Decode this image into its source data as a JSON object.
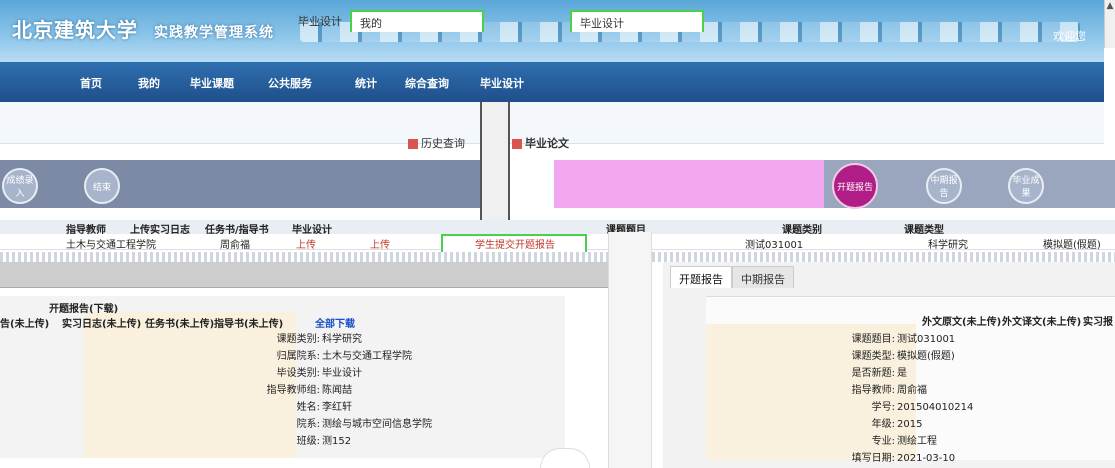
{
  "header": {
    "logo_text": "北京建筑大学",
    "subtitle": "实践教学管理系统",
    "user_text": "欢迎您"
  },
  "nav": {
    "items": [
      "首页",
      "我的",
      "毕业课题",
      "公共服务",
      "统计",
      "综合查询",
      "毕业设计"
    ]
  },
  "tabs": {
    "items": [
      "毕业设计",
      "我的",
      "毕业设计"
    ],
    "history": "历史查询",
    "thesis": "毕业论文"
  },
  "steps": {
    "left": [
      "成绩录入",
      "结束"
    ],
    "right": [
      "开题报告",
      "中期报告",
      "毕业成果"
    ],
    "active": "开题报告"
  },
  "table": {
    "headers": [
      "指导教师",
      "上传实习日志",
      "任务书/指导书",
      "毕业设计",
      "课题题目",
      "课题类别",
      "课题类型"
    ],
    "row": {
      "college": "土木与交通工程学院",
      "teacher": "周俞福",
      "upload1": "上传",
      "upload2": "上传",
      "submit": "学生提交开题报告",
      "topic": "测试031001",
      "category": "科学研究",
      "type": "模拟题(假题)"
    }
  },
  "left_panel": {
    "title": "开题报告(下载)",
    "links": [
      "告(未上传)",
      "实习日志(未上传)",
      "任务书(未上传)",
      "指导书(未上传)"
    ],
    "download_all": "全部下载",
    "fields": [
      {
        "k": "课题类别:",
        "v": "科学研究"
      },
      {
        "k": "归属院系:",
        "v": "土木与交通工程学院"
      },
      {
        "k": "毕设类别:",
        "v": "毕业设计"
      },
      {
        "k": "指导教师组:",
        "v": "陈闻喆"
      },
      {
        "k": "姓名:",
        "v": "李红轩"
      },
      {
        "k": "院系:",
        "v": "测绘与城市空间信息学院"
      },
      {
        "k": "班级:",
        "v": "测152"
      }
    ]
  },
  "right_panel": {
    "tabs": [
      "开题报告",
      "中期报告"
    ],
    "links": [
      "外文原文(未上传)",
      "外文译文(未上传)",
      "实习报"
    ],
    "fields": [
      {
        "k": "课题题目:",
        "v": "测试031001"
      },
      {
        "k": "课题类型:",
        "v": "模拟题(假题)"
      },
      {
        "k": "是否新题:",
        "v": "是"
      },
      {
        "k": "指导教师:",
        "v": "周俞福"
      },
      {
        "k": "学号:",
        "v": "201504010214"
      },
      {
        "k": "年级:",
        "v": "2015"
      },
      {
        "k": "专业:",
        "v": "测绘工程"
      },
      {
        "k": "填写日期:",
        "v": "2021-03-10"
      }
    ]
  }
}
